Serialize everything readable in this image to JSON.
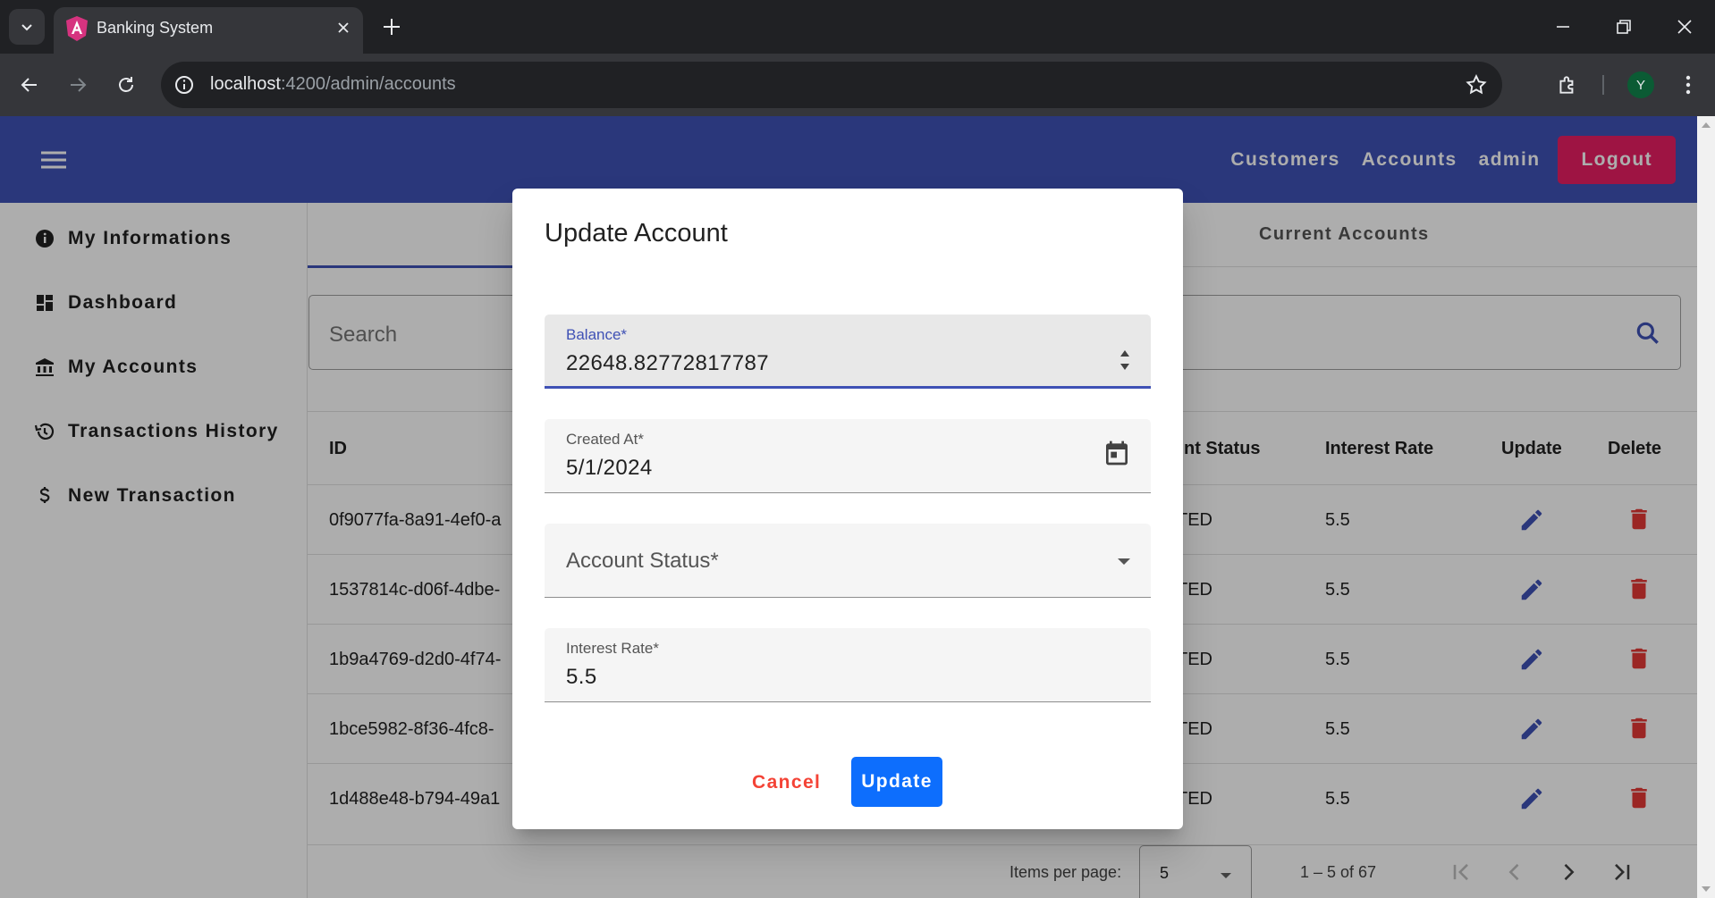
{
  "browser": {
    "tab_title": "Banking System",
    "url_host": "localhost",
    "url_path": ":4200/admin/accounts",
    "profile_initial": "Y"
  },
  "header": {
    "nav": [
      "Customers",
      "Accounts",
      "admin"
    ],
    "logout_label": "Logout"
  },
  "sidebar": {
    "items": [
      {
        "label": "My Informations",
        "icon": "info-icon"
      },
      {
        "label": "Dashboard",
        "icon": "dashboard-icon"
      },
      {
        "label": "My Accounts",
        "icon": "bank-icon"
      },
      {
        "label": "Transactions History",
        "icon": "history-icon"
      },
      {
        "label": "New Transaction",
        "icon": "dollar-icon"
      }
    ]
  },
  "main": {
    "tab_current": "Current Accounts",
    "search_placeholder": "Search",
    "columns": {
      "id": "ID",
      "status": "nt Status",
      "rate": "Interest Rate",
      "update": "Update",
      "delete": "Delete"
    },
    "rows": [
      {
        "id": "0f9077fa-8a91-4ef0-a",
        "status": "TED",
        "rate": "5.5"
      },
      {
        "id": "1537814c-d06f-4dbe-",
        "status": "TED",
        "rate": "5.5"
      },
      {
        "id": "1b9a4769-d2d0-4f74-",
        "status": "TED",
        "rate": "5.5"
      },
      {
        "id": "1bce5982-8f36-4fc8-",
        "status": "TED",
        "rate": "5.5"
      },
      {
        "id": "1d488e48-b794-49a1",
        "status": "TED",
        "rate": "5.5"
      }
    ],
    "paginator": {
      "label": "Items per page:",
      "page_size": "5",
      "range": "1 – 5 of 67"
    }
  },
  "dialog": {
    "title": "Update Account",
    "balance_label": "Balance*",
    "balance_value": "22648.82772817787",
    "created_label": "Created At*",
    "created_value": "5/1/2024",
    "status_placeholder": "Account Status*",
    "rate_label": "Interest Rate*",
    "rate_value": "5.5",
    "cancel_label": "Cancel",
    "update_label": "Update"
  },
  "colors": {
    "primary": "#3f51b5",
    "logout": "#e91e63",
    "cancel": "#f44336",
    "update_button": "#0d6efd",
    "delete_icon": "#e53935"
  }
}
